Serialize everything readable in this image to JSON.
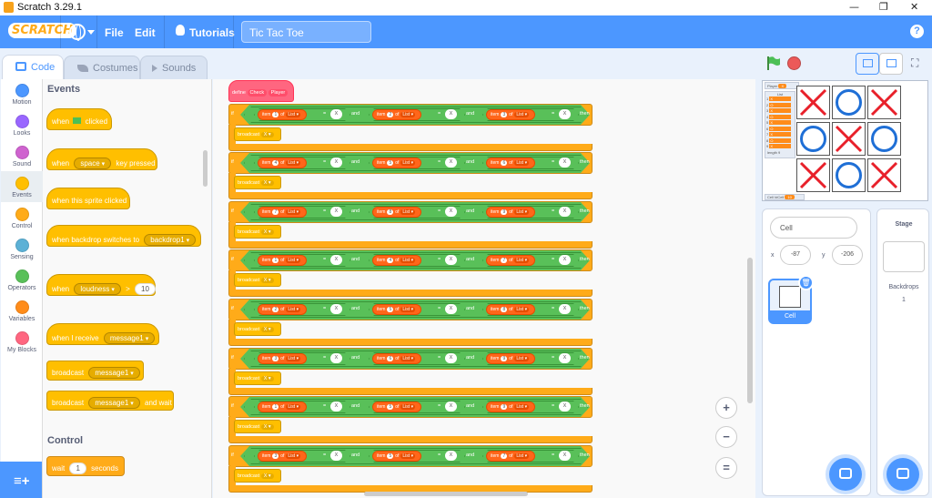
{
  "window": {
    "title": "Scratch 3.29.1",
    "controls": [
      "—",
      "❐",
      "✕"
    ]
  },
  "menubar": {
    "logo": "SCRATCH",
    "file": "File",
    "edit": "Edit",
    "tutorials": "Tutorials",
    "project_title": "Tic Tac Toe",
    "help": "?"
  },
  "tabs": [
    {
      "label": "Code",
      "icon": "code-icon"
    },
    {
      "label": "Costumes",
      "icon": "brush-icon"
    },
    {
      "label": "Sounds",
      "icon": "speaker-icon"
    }
  ],
  "categories": [
    {
      "label": "Motion",
      "color": "#4c97ff"
    },
    {
      "label": "Looks",
      "color": "#9966ff"
    },
    {
      "label": "Sound",
      "color": "#cf63cf"
    },
    {
      "label": "Events",
      "color": "#ffbf00"
    },
    {
      "label": "Control",
      "color": "#ffab19"
    },
    {
      "label": "Sensing",
      "color": "#5cb1d6"
    },
    {
      "label": "Operators",
      "color": "#59c059"
    },
    {
      "label": "Variables",
      "color": "#ff8c1a"
    },
    {
      "label": "My Blocks",
      "color": "#ff6680"
    }
  ],
  "palette": {
    "events_heading": "Events",
    "control_heading": "Control",
    "when_flag": {
      "pre": "when",
      "post": "clicked"
    },
    "when_key": {
      "pre": "when",
      "key": "space",
      "post": "key pressed"
    },
    "when_sprite": "when this sprite clicked",
    "when_backdrop": {
      "pre": "when backdrop switches to",
      "value": "backdrop1"
    },
    "when_loudness": {
      "pre": "when",
      "value": "loudness",
      "op": ">",
      "num": "10"
    },
    "when_receive": {
      "pre": "when I receive",
      "value": "message1"
    },
    "broadcast": {
      "pre": "broadcast",
      "value": "message1"
    },
    "broadcast_wait": {
      "pre": "broadcast",
      "value": "message1",
      "post": "and wait"
    },
    "wait": {
      "pre": "wait",
      "num": "1",
      "post": "seconds"
    }
  },
  "script": {
    "define": {
      "kw": "define",
      "name": "Check",
      "arg": "Player"
    },
    "if_kw": "if",
    "then_kw": "then",
    "and_kw": "and",
    "item_kw": "item",
    "of_kw": "of",
    "list_name": "List",
    "eq": "=",
    "x_val": "X",
    "broadcast_kw": "broadcast",
    "broadcast_val": "X",
    "rows": [
      {
        "a": "1",
        "b": "2",
        "c": "3"
      },
      {
        "a": "4",
        "b": "5",
        "c": "6"
      },
      {
        "a": "7",
        "b": "8",
        "c": "9"
      },
      {
        "a": "1",
        "b": "4",
        "c": "7"
      },
      {
        "a": "2",
        "b": "5",
        "c": "8"
      },
      {
        "a": "3",
        "b": "6",
        "c": "9"
      },
      {
        "a": "1",
        "b": "5",
        "c": "9"
      },
      {
        "a": "3",
        "b": "5",
        "c": "7"
      }
    ]
  },
  "zoom": {
    "in": "+",
    "out": "−",
    "reset": "="
  },
  "stage": {
    "player_label": "Player",
    "player_value": "X",
    "list_title": "List",
    "list_items": [
      "X",
      "O",
      "X",
      "O",
      "X",
      "O",
      "X",
      "O",
      "X"
    ],
    "list_length": "length 9",
    "cell_var": "Cell IdCell",
    "cell_var_value": "10",
    "board": [
      "X",
      "O",
      "X",
      "O",
      "X",
      "O",
      "X",
      "O",
      "X"
    ]
  },
  "sprite_info": {
    "name": "Cell",
    "x_label": "x",
    "x_value": "-87",
    "y_label": "y",
    "y_value": "-206"
  },
  "sprite_list": {
    "sprite_name": "Cell"
  },
  "stage_panel": {
    "heading": "Stage",
    "backdrops_label": "Backdrops",
    "backdrops_count": "1"
  }
}
